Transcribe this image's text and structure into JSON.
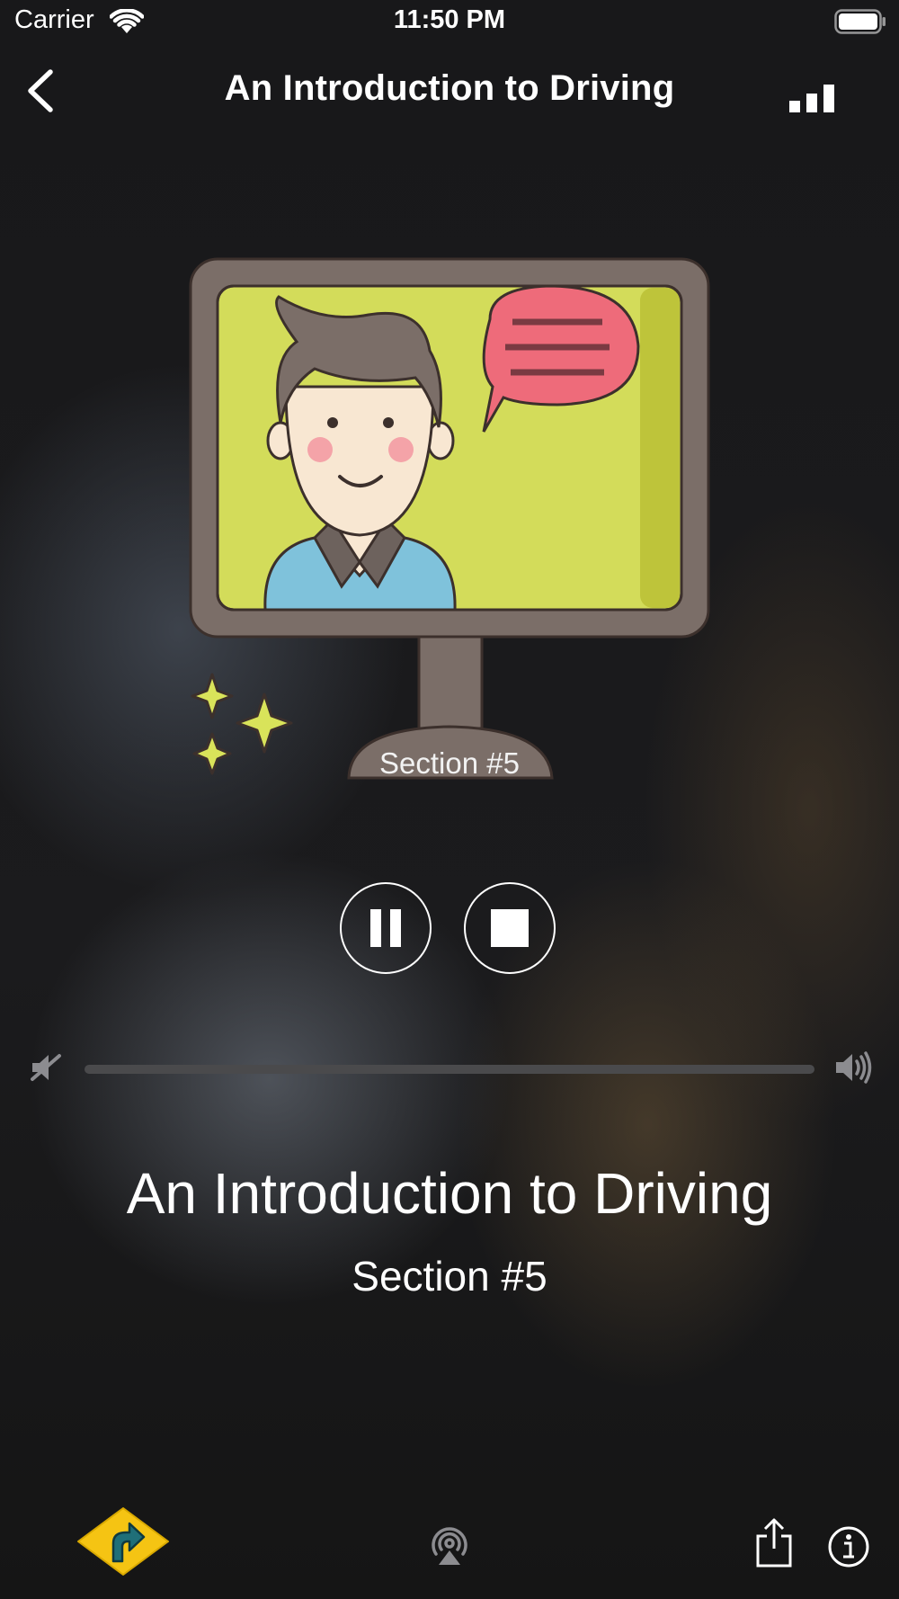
{
  "status_bar": {
    "carrier": "Carrier",
    "time": "11:50 PM"
  },
  "nav": {
    "title": "An Introduction to Driving",
    "back_icon": "chevron-left-icon",
    "right_icon": "signal-bars-icon"
  },
  "artwork": {
    "caption": "Section #5"
  },
  "controls": {
    "pause_icon": "pause-icon",
    "stop_icon": "stop-icon"
  },
  "volume": {
    "level": 0.0,
    "min_icon": "volume-mute-icon",
    "max_icon": "volume-high-icon"
  },
  "now_playing": {
    "title": "An Introduction to Driving",
    "subtitle": "Section #5"
  },
  "toolbar": {
    "left_icon": "road-turn-sign-icon",
    "center_icon": "airplay-icon",
    "share_icon": "share-icon",
    "info_icon": "info-icon"
  },
  "colors": {
    "sign_yellow": "#F5C413",
    "sign_arrow": "#1F6F78",
    "screen_green": "#D3DC5A",
    "monitor_frame": "#7B6E68",
    "bubble_pink": "#EE6B7A",
    "shirt_blue": "#7FC2DB",
    "sparkle": "#D9E35A"
  }
}
